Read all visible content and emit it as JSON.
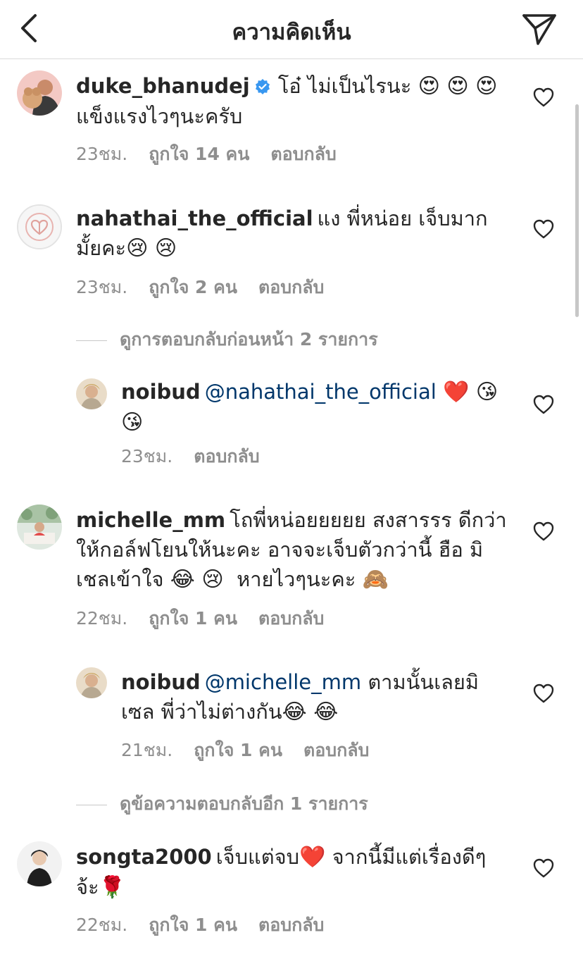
{
  "header": {
    "title": "ความคิดเห็น",
    "back_icon": "chevron-left-icon",
    "share_icon": "paper-plane-icon"
  },
  "comments": [
    {
      "username": "duke_bhanudej",
      "verified": true,
      "text_line1": "โอ๋ ไม่เป็นไรนะ",
      "emojis_line1": "😍 😍 😍",
      "text_line2": "แข็งแรงไวๆนะครับ",
      "time": "23ชม.",
      "likes": "ถูกใจ 14 คน",
      "reply": "ตอบกลับ"
    },
    {
      "username": "nahathai_the_official",
      "text_line1": "แง พี่หน่อย เจ็บมาก",
      "text_line2": "มั้ยคะ",
      "emojis_line2": "😢 😢",
      "time": "23ชม.",
      "likes": "ถูกใจ 2 คน",
      "reply": "ตอบกลับ"
    },
    {
      "view_replies": "ดูการตอบกลับก่อนหน้า 2 รายการ"
    },
    {
      "username": "noibud",
      "mention": "@nahathai_the_official",
      "emojis_line1": "❤️ 😘",
      "emojis_line2": "😘",
      "time": "23ชม.",
      "reply": "ตอบกลับ"
    },
    {
      "username": "michelle_mm",
      "text_line1": "โถพี่หน่อยยยยย สงสารรร ดีกว่า",
      "text_line2": "ให้กอล์ฟโยนให้นะคะ อาจจะเจ็บตัวกว่านี้ ฮือ มิ",
      "text_line3a": "เชลเข้าใจ",
      "emojis_line3a": "😂 😢",
      "text_line3b": "หายไวๆนะคะ",
      "emojis_line3b": "🙈",
      "time": "22ชม.",
      "likes": "ถูกใจ 1 คน",
      "reply": "ตอบกลับ"
    },
    {
      "username": "noibud",
      "mention": "@michelle_mm",
      "text_line1": "ตามนั้นเลยมิ",
      "text_line2": "เซล พี่ว่าไม่ต่างกัน",
      "emojis_line2": "😂 😂",
      "time": "21ชม.",
      "likes": "ถูกใจ 1 คน",
      "reply": "ตอบกลับ"
    },
    {
      "view_replies": "ดูข้อความตอบกลับอีก 1 รายการ"
    },
    {
      "username": "songta2000",
      "text_line1": "เจ็บแต่จบ",
      "emojis_line1a": "❤️",
      "text_line1b": "จากนี้มีแต่เรื่องดีๆ",
      "text_line2": "จ้ะ",
      "emojis_line2": "🌹",
      "time": "22ชม.",
      "likes": "ถูกใจ 1 คน",
      "reply": "ตอบกลับ"
    }
  ],
  "colors": {
    "text": "#262626",
    "secondary": "#8e8e8e",
    "mention": "#00376b",
    "verified": "#3897f0",
    "divider": "#dbdbdb"
  }
}
